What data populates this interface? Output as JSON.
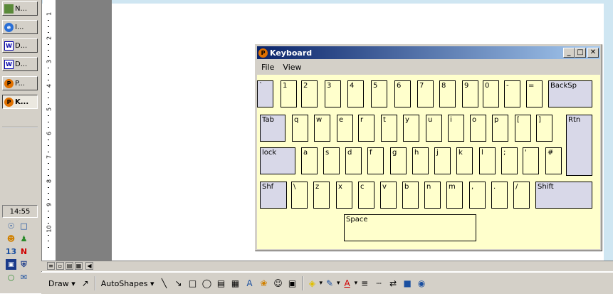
{
  "taskbar": {
    "buttons": [
      {
        "label": "N...",
        "icon": "image-icon"
      },
      {
        "label": "I...",
        "icon": "ie-icon"
      },
      {
        "label": "D...",
        "icon": "word-doc-icon"
      },
      {
        "label": "D...",
        "icon": "word-doc-icon"
      },
      {
        "label": "P...",
        "icon": "pgp-icon"
      },
      {
        "label": "K...",
        "icon": "pgp-icon"
      }
    ],
    "clock": "14:55"
  },
  "ruler": {
    "marks": [
      "1",
      "2",
      "3",
      "4",
      "5",
      "6",
      "7",
      "8",
      "9",
      "10"
    ]
  },
  "keyboard_window": {
    "title": "Keyboard",
    "menu": [
      "File",
      "View"
    ],
    "keys": {
      "row1": [
        "`",
        "1",
        "2",
        "3",
        "4",
        "5",
        "6",
        "7",
        "8",
        "9",
        "0",
        "-",
        "="
      ],
      "backspace": "BackSp",
      "tab": "Tab",
      "row2": [
        "q",
        "w",
        "e",
        "r",
        "t",
        "y",
        "u",
        "i",
        "o",
        "p",
        "[",
        "]"
      ],
      "return": "Rtn",
      "lock": "lock",
      "row3": [
        "a",
        "s",
        "d",
        "f",
        "g",
        "h",
        "j",
        "k",
        "l",
        ";",
        "'",
        "#"
      ],
      "left_shift": "Shf",
      "row4": [
        "\\",
        "z",
        "x",
        "c",
        "v",
        "b",
        "n",
        "m",
        ",",
        ".",
        "/"
      ],
      "right_shift": "Shift",
      "space": "Space"
    }
  },
  "drawing_toolbar": {
    "draw_label": "Draw",
    "autoshapes_label": "AutoShapes"
  },
  "colors": {
    "key_bg": "#ffffcc",
    "modifier_key_bg": "#d8d8e8",
    "titlebar_start": "#0a246a",
    "titlebar_end": "#a6caf0"
  }
}
